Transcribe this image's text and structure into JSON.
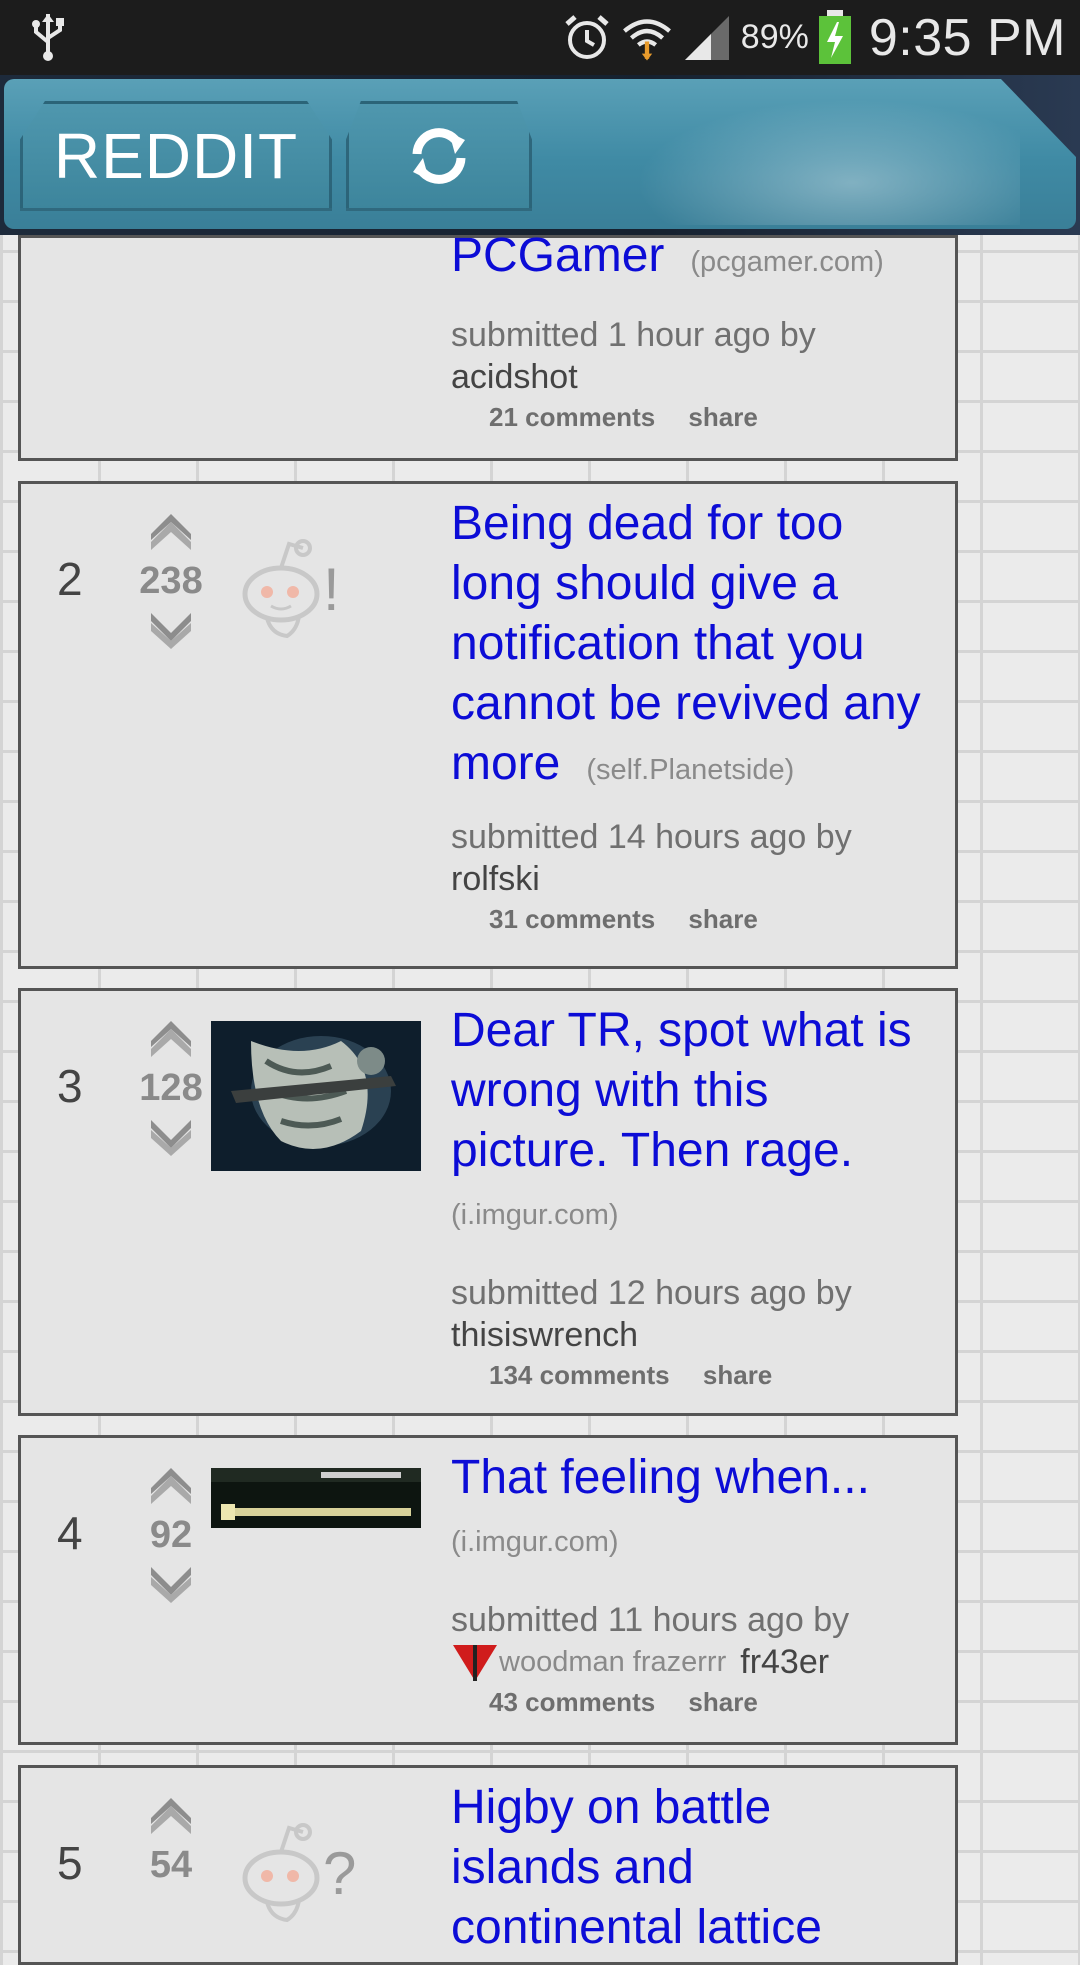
{
  "status_bar": {
    "battery": "89%",
    "time": "9:35 PM",
    "icons": [
      "usb-icon",
      "alarm-icon",
      "wifi-icon",
      "signal-icon",
      "battery-icon"
    ]
  },
  "header": {
    "reddit_label": "REDDIT",
    "refresh_icon": "refresh-icon"
  },
  "posts": [
    {
      "title": "PCGamer",
      "domain": "(pcgamer.com)",
      "submitted": "submitted 1 hour ago by",
      "author": "acidshot",
      "comments": "21 comments",
      "share": "share"
    },
    {
      "rank": "2",
      "score": "238",
      "title": "Being dead for too long should give a notification that you cannot be revived any more",
      "domain": "(self.Planetside)",
      "submitted": "submitted 14 hours ago by",
      "author": "rolfski",
      "comments": "31 comments",
      "share": "share",
      "thumb": "reddit-alien-exclaim-icon"
    },
    {
      "rank": "3",
      "score": "128",
      "title": "Dear TR, spot what is wrong with this picture. Then rage.",
      "domain": "(i.imgur.com)",
      "submitted": "submitted 12 hours ago by",
      "author": "thisiswrench",
      "comments": "134 comments",
      "share": "share",
      "thumb": "armored-soldier-thumbnail"
    },
    {
      "rank": "4",
      "score": "92",
      "title": "That feeling when...",
      "domain": "(i.imgur.com)",
      "submitted": "submitted 11 hours ago by",
      "flair": "woodman frazerrr",
      "author": "fr43er",
      "comments": "43 comments",
      "share": "share",
      "thumb": "game-hud-thumbnail"
    },
    {
      "rank": "5",
      "score": "54",
      "title": "Higby on battle islands and continental lattice",
      "thumb": "reddit-alien-question-icon"
    }
  ],
  "colors": {
    "link": "#0c0cd6",
    "card_bg": "#e5e5e5",
    "header_teal": "#4f97ae"
  }
}
